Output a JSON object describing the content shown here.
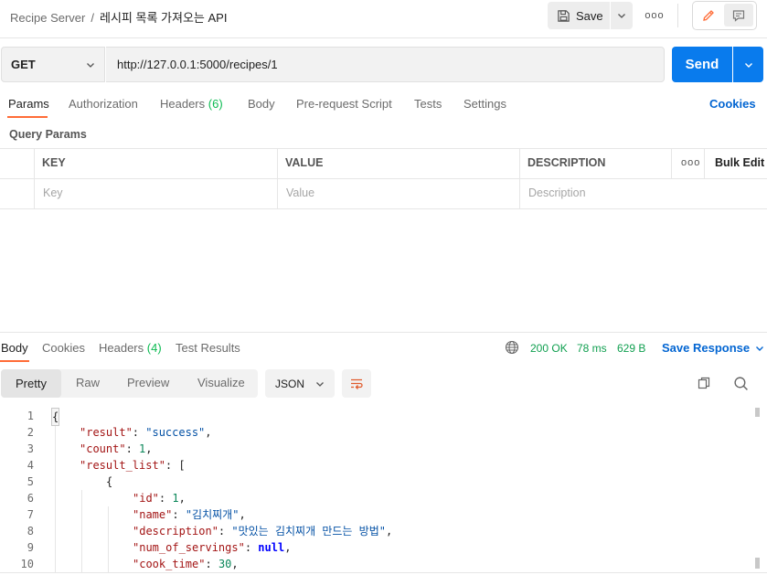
{
  "header": {
    "collection": "Recipe Server",
    "separator": "/",
    "request_name": "레시피 목록 가져오는 API",
    "save_label": "Save",
    "more_label": "ooo"
  },
  "request": {
    "method": "GET",
    "url": "http://127.0.0.1:5000/recipes/1",
    "send_label": "Send"
  },
  "request_tabs": [
    {
      "label": "Params",
      "count": ""
    },
    {
      "label": "Authorization",
      "count": ""
    },
    {
      "label": "Headers",
      "count": "(6)"
    },
    {
      "label": "Body",
      "count": ""
    },
    {
      "label": "Pre-request Script",
      "count": ""
    },
    {
      "label": "Tests",
      "count": ""
    },
    {
      "label": "Settings",
      "count": ""
    }
  ],
  "cookies_label": "Cookies",
  "query_params": {
    "title": "Query Params",
    "columns": [
      "KEY",
      "VALUE",
      "DESCRIPTION"
    ],
    "more_label": "ooo",
    "bulk_edit_label": "Bulk Edit",
    "placeholders": {
      "key": "Key",
      "value": "Value",
      "description": "Description"
    }
  },
  "response_tabs": [
    {
      "label": "Body",
      "count": ""
    },
    {
      "label": "Cookies",
      "count": ""
    },
    {
      "label": "Headers",
      "count": "(4)"
    },
    {
      "label": "Test Results",
      "count": ""
    }
  ],
  "response_status": {
    "status": "200 OK",
    "time": "78 ms",
    "size": "629 B",
    "save_response_label": "Save Response"
  },
  "response_view": {
    "options": [
      "Pretty",
      "Raw",
      "Preview",
      "Visualize"
    ],
    "selected": "Pretty",
    "format": "JSON"
  },
  "code_lines": [
    {
      "num": "1",
      "text": "{"
    },
    {
      "num": "2",
      "text": "\"result\": \"success\","
    },
    {
      "num": "3",
      "text": "\"count\": 1,"
    },
    {
      "num": "4",
      "text": "\"result_list\": ["
    },
    {
      "num": "5",
      "text": "{"
    },
    {
      "num": "6",
      "text": "\"id\": 1,"
    },
    {
      "num": "7",
      "text": "\"name\": \"김치찌개\","
    },
    {
      "num": "8",
      "text": "\"description\": \"맛있는 김치찌개 만드는 방법\","
    },
    {
      "num": "9",
      "text": "\"num_of_servings\": null,"
    },
    {
      "num": "10",
      "text": "\"cook_time\": 30,"
    }
  ],
  "colors": {
    "accent": "#ff6c37",
    "send_button": "#097bed",
    "link": "#0265d2",
    "status_ok": "#0f9f4f",
    "count_badge": "#0cbb52"
  },
  "icons": [
    "save-icon",
    "chevron-down-icon",
    "more-icon",
    "pencil-icon",
    "comment-icon",
    "globe-icon",
    "wrap-lines-icon",
    "copy-icon",
    "search-icon"
  ]
}
